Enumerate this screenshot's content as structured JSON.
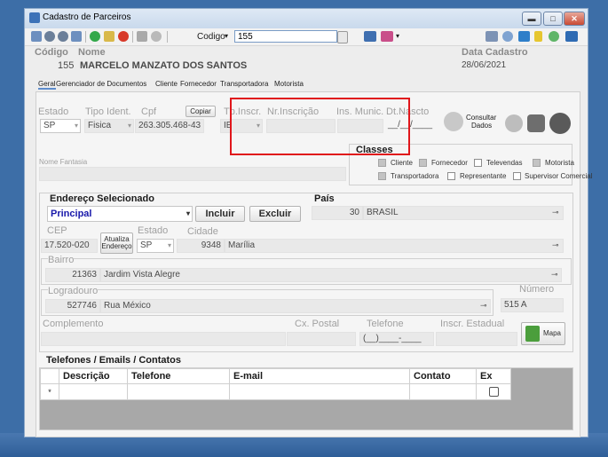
{
  "window": {
    "title": "Cadastro de Parceiros"
  },
  "toolbar": {
    "codigo_label": "Codigo",
    "codigo_value": "155"
  },
  "header": {
    "codigo_label": "Código",
    "nome_label": "Nome",
    "codigo_value": "155",
    "nome_value": "MARCELO MANZATO DOS SANTOS",
    "data_cadastro_label": "Data Cadastro",
    "data_cadastro_value": "28/06/2021"
  },
  "tabs": [
    "Geral",
    "Gerenciador de Documentos",
    "Cliente",
    "Fornecedor",
    "Transportadora",
    "Motorista"
  ],
  "identity": {
    "estado_label": "Estado",
    "estado_value": "SP",
    "tipo_label": "Tipo Ident.",
    "tipo_value": "Fisica",
    "cpf_label": "Cpf",
    "cpf_value": "263.305.468-43",
    "copiar_label": "Copiar",
    "tp_inscr_label": "Tp.Inscr.",
    "tp_inscr_value": "IE",
    "nr_inscricao_label": "Nr.Inscrição",
    "ins_munic_label": "Ins. Munic.",
    "dt_nascto_label": "Dt.Nascto",
    "dt_nascto_value": "__/__/____",
    "consultar_label_1": "Consultar",
    "consultar_label_2": "Dados"
  },
  "nome_fantasia_label": "Nome Fantasia",
  "classes": {
    "title": "Classes",
    "items": [
      {
        "label": "Cliente",
        "checked": true
      },
      {
        "label": "Fornecedor",
        "checked": true
      },
      {
        "label": "Televendas",
        "checked": false
      },
      {
        "label": "Motorista",
        "checked": true
      },
      {
        "label": "Transportadora",
        "checked": true
      },
      {
        "label": "Representante",
        "checked": false
      },
      {
        "label": "Supervisor Comercial",
        "checked": false
      }
    ]
  },
  "endereco": {
    "title": "Endereço Selecionado",
    "value": "Principal",
    "incluir_label": "Incluir",
    "excluir_label": "Excluir",
    "pais_label": "País",
    "pais_code": "30",
    "pais_name": "BRASIL",
    "cep_label": "CEP",
    "cep_value": "17.520-020",
    "atualiza_label_1": "Atualiza",
    "atualiza_label_2": "Endereço",
    "estado_label": "Estado",
    "estado_value": "SP",
    "cidade_label": "Cidade",
    "cidade_code": "9348",
    "cidade_name": "Marília",
    "bairro_label": "Bairro",
    "bairro_code": "21363",
    "bairro_name": "Jardim Vista Alegre",
    "logradouro_label": "Logradouro",
    "logradouro_code": "527746",
    "logradouro_name": "Rua México",
    "numero_label": "Número",
    "numero_value": "515 A",
    "complemento_label": "Complemento",
    "cx_postal_label": "Cx. Postal",
    "telefone_label": "Telefone",
    "telefone_value": "(__)____-____",
    "inscr_estadual_label": "Inscr. Estadual",
    "mapa_label": "Mapa"
  },
  "contatos": {
    "title": "Telefones / Emails / Contatos",
    "columns": [
      "Descrição",
      "Telefone",
      "E-mail",
      "Contato",
      "Ex"
    ],
    "row_marker": "*"
  }
}
